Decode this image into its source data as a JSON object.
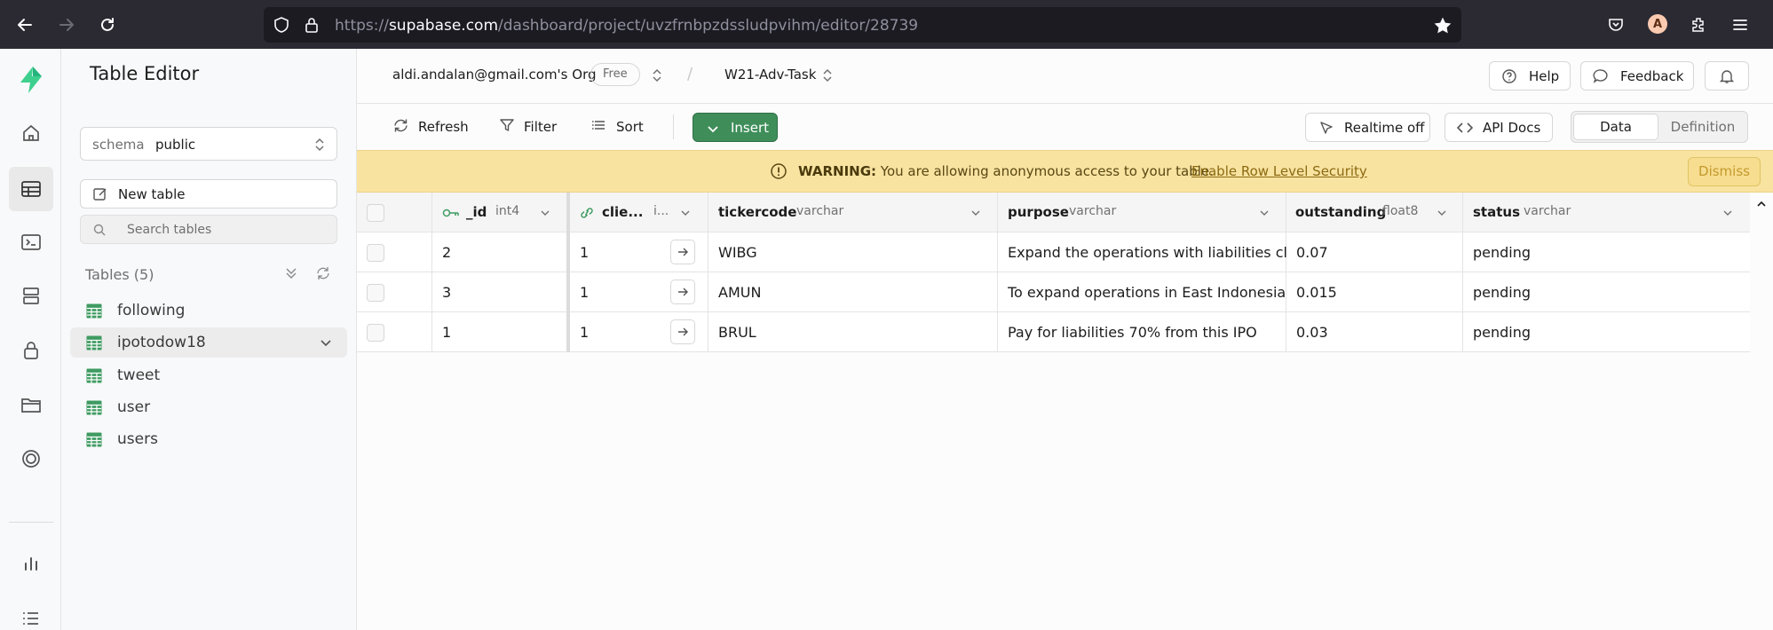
{
  "browser": {
    "url_prefix": "https://",
    "url_host": "supabase.com",
    "url_path": "/dashboard/project/uvzfrnbpzdssludpvihm/editor/28739",
    "avatar_letter": "A"
  },
  "sidebar": {
    "title": "Table Editor",
    "schema_label": "schema",
    "schema_value": "public",
    "new_table_label": "New table",
    "search_placeholder": "Search tables",
    "tables_heading": "Tables (5)",
    "tables": [
      {
        "label": "following",
        "active": false
      },
      {
        "label": "ipotodow18",
        "active": true
      },
      {
        "label": "tweet",
        "active": false
      },
      {
        "label": "user",
        "active": false
      },
      {
        "label": "users",
        "active": false
      }
    ]
  },
  "header": {
    "org": "aldi.andalan@gmail.com's Org",
    "plan_badge": "Free",
    "project": "W21-Adv-Task",
    "help_label": "Help",
    "feedback_label": "Feedback"
  },
  "toolbar": {
    "refresh_label": "Refresh",
    "filter_label": "Filter",
    "sort_label": "Sort",
    "insert_label": "Insert",
    "realtime_label": "Realtime off",
    "api_docs_label": "API Docs",
    "view_data_label": "Data",
    "view_definition_label": "Definition"
  },
  "warning": {
    "strong": "WARNING:",
    "message": " You are allowing anonymous access to your table.",
    "link": "Enable Row Level Security",
    "dismiss_label": "Dismiss"
  },
  "grid": {
    "columns": [
      {
        "name": "_id",
        "type": "int4"
      },
      {
        "name": "clie...",
        "type": "i..."
      },
      {
        "name": "tickercode",
        "type": "varchar"
      },
      {
        "name": "purpose",
        "type": "varchar"
      },
      {
        "name": "outstanding",
        "type": "float8"
      },
      {
        "name": "status",
        "type": "varchar"
      }
    ],
    "rows": [
      {
        "id": "2",
        "client": "1",
        "tickercode": "WIBG",
        "purpose": "Expand the operations with liabilities clea",
        "outstanding": "0.07",
        "status": "pending"
      },
      {
        "id": "3",
        "client": "1",
        "tickercode": "AMUN",
        "purpose": "To expand operations in East Indonesia",
        "outstanding": "0.015",
        "status": "pending"
      },
      {
        "id": "1",
        "client": "1",
        "tickercode": "BRUL",
        "purpose": "Pay for liabilities 70% from this IPO",
        "outstanding": "0.03",
        "status": "pending"
      }
    ]
  },
  "colors": {
    "brand_green": "#3ecf8e",
    "insert_button": "#3f8e5a",
    "warning_bg": "#f8e3a1"
  }
}
